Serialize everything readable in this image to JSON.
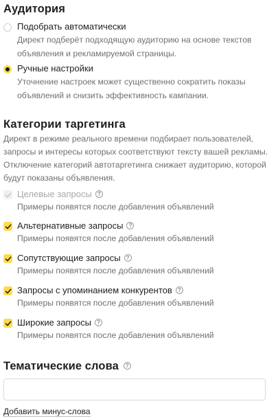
{
  "audience": {
    "title": "Аудитория",
    "options": [
      {
        "label": "Подобрать автоматически",
        "desc_lines": [
          "Директ подберёт подходящую аудиторию на основе текстов",
          "объявления и рекламируемой страницы."
        ],
        "selected": false
      },
      {
        "label": "Ручные настройки",
        "desc_lines": [
          "Уточнение настроек может существенно сократить показы",
          "объявлений и снизить эффективность кампании."
        ],
        "selected": true
      }
    ]
  },
  "targeting": {
    "title": "Категории таргетинга",
    "desc_lines": [
      "Директ в режиме реального времени подбирает пользователей,",
      "запросы и интересы которых соответствуют тексту вашей рекламы.",
      "Отключение категорий автотаргетинга снижает аудиторию, которой",
      "будут показаны объявления."
    ],
    "categories": [
      {
        "label": "Целевые запросы",
        "hint": "Примеры появятся после добавления объявлений",
        "checked": true,
        "disabled": true
      },
      {
        "label": "Альтернативные запросы",
        "hint": "Примеры появятся после добавления объявлений",
        "checked": true,
        "disabled": false
      },
      {
        "label": "Сопутствующие запросы",
        "hint": "Примеры появятся после добавления объявлений",
        "checked": true,
        "disabled": false
      },
      {
        "label": "Запросы с упоминанием конкурентов",
        "hint": "Примеры появятся после добавления объявлений",
        "checked": true,
        "disabled": false
      },
      {
        "label": "Широкие запросы",
        "hint": "Примеры появятся после добавления объявлений",
        "checked": true,
        "disabled": false
      }
    ]
  },
  "thematic": {
    "title": "Тематические слова",
    "input_value": "",
    "add_minus_link": "Добавить минус-слова"
  },
  "icons": {
    "help": "?",
    "check": "check-icon"
  },
  "colors": {
    "accent": "#ffdb4d",
    "text": "#1f1f1f",
    "muted": "#707070"
  }
}
